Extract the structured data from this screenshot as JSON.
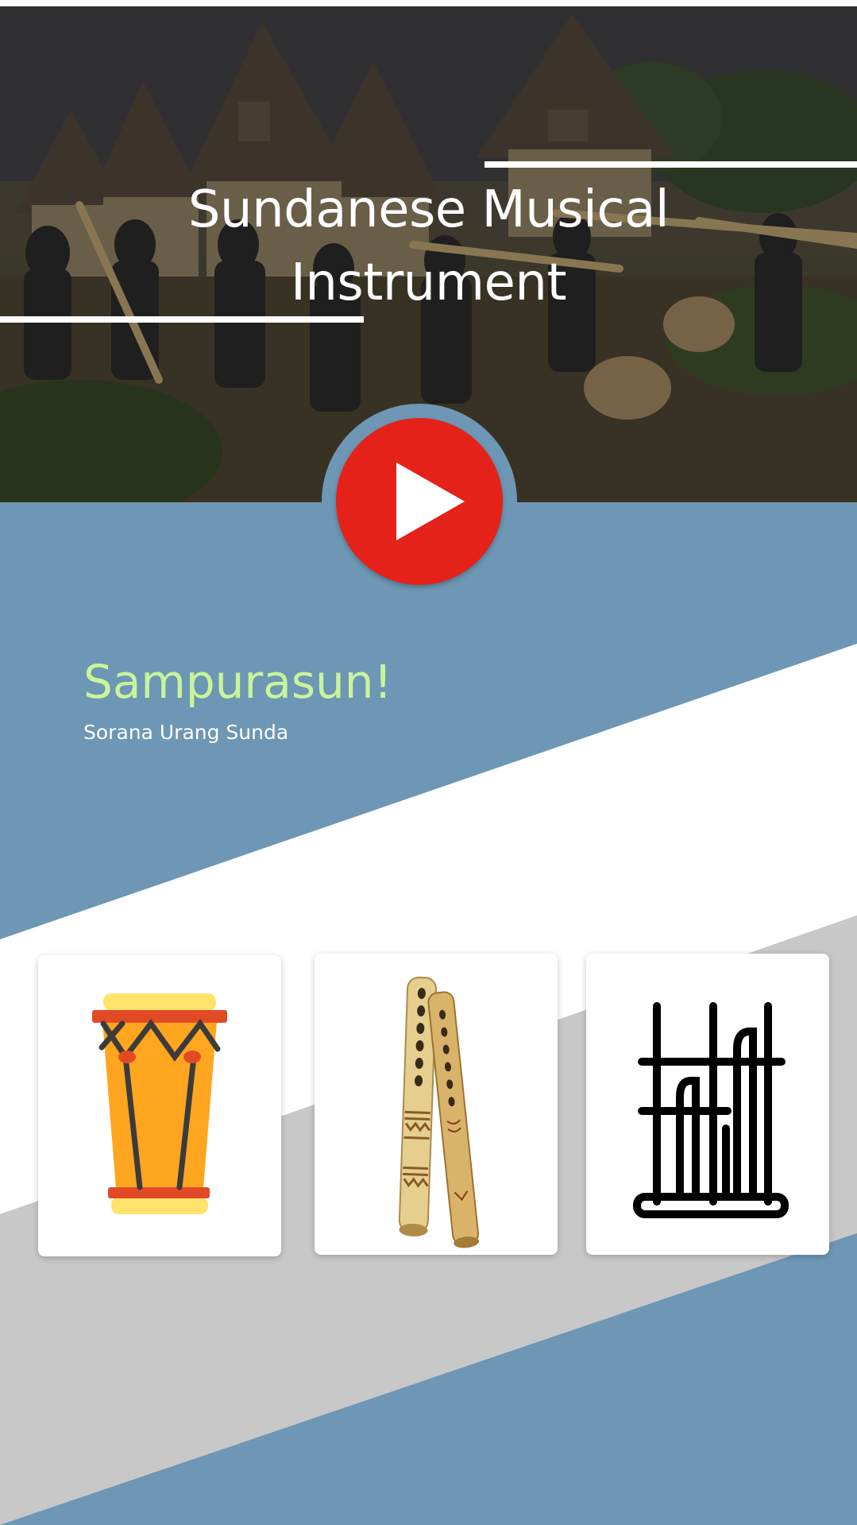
{
  "hero": {
    "title_line1": "Sundanese Musical",
    "title_line2": "Instrument"
  },
  "play_button": {
    "icon": "play-icon"
  },
  "greeting": {
    "title": "Sampurasun!",
    "subtitle": "Sorana Urang Sunda"
  },
  "instruments": [
    {
      "icon": "kendang-drum-icon"
    },
    {
      "icon": "suling-flute-icon"
    },
    {
      "icon": "angklung-icon"
    }
  ],
  "colors": {
    "background_blue": "#6d97b4",
    "greeting_green": "#c8f59b",
    "play_red": "#e4221a",
    "diagonal_white": "#ffffff",
    "diagonal_gray": "#c8c8c8"
  }
}
